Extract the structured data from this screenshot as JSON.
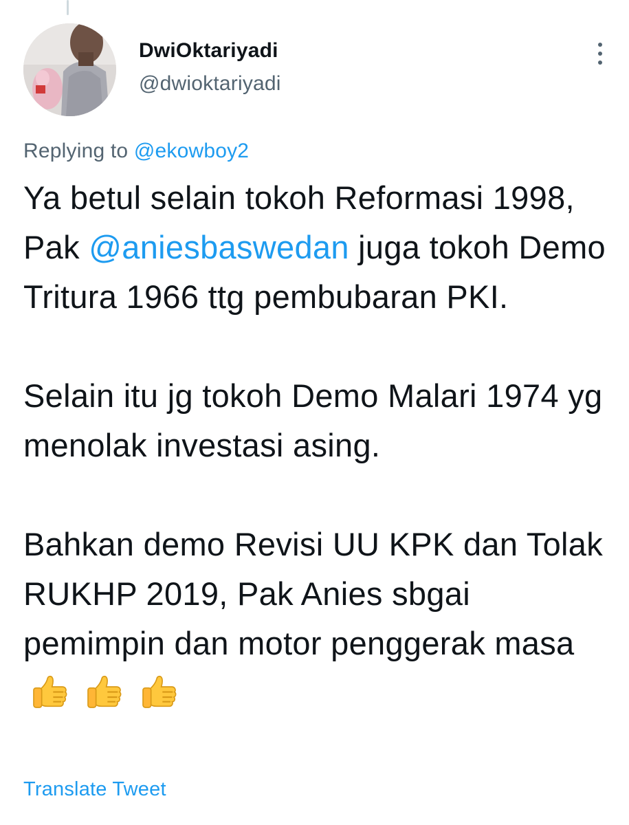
{
  "tweet": {
    "author": {
      "display_name": "DwiOktariyadi",
      "handle": "@dwioktariyadi"
    },
    "replying_label": "Replying to",
    "replying_to": "@ekowboy2",
    "body": {
      "p1_part1": "Ya betul selain tokoh Reformasi 1998, Pak ",
      "p1_mention": "@aniesbaswedan",
      "p1_part2": " juga tokoh Demo Tritura 1966 ttg pembubaran PKI.",
      "p2": "Selain itu jg tokoh Demo Malari 1974 yg menolak investasi asing.",
      "p3": "Bahkan demo Revisi UU KPK dan Tolak RUKHP 2019, Pak Anies sbgai pemimpin dan motor penggerak masa",
      "emojis": [
        "thumbs-up-icon",
        "thumbs-up-icon",
        "thumbs-up-icon"
      ]
    },
    "translate_label": "Translate Tweet"
  },
  "colors": {
    "text": "#0f1419",
    "secondary": "#536471",
    "link": "#1d9bf0",
    "thread_line": "#cfd9de",
    "emoji": "#ffc83d"
  }
}
